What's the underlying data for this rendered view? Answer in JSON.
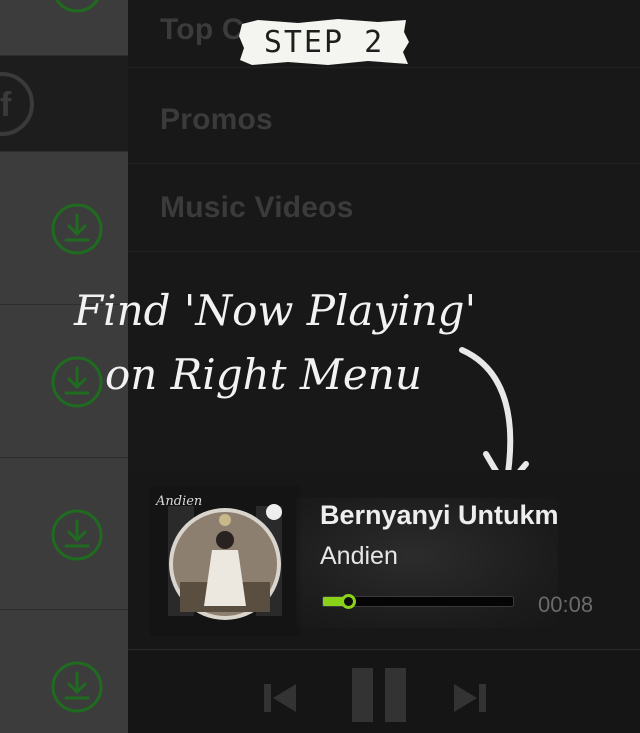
{
  "annotation": {
    "step": "STEP 2",
    "instruction_line1": "Find 'Now Playing'",
    "instruction_line2": "on Right Menu"
  },
  "menu": {
    "items": [
      {
        "label": "Top C"
      },
      {
        "label": "Promos"
      },
      {
        "label": "Music Videos"
      }
    ]
  },
  "now_playing": {
    "album_brand": "Andien",
    "song_title": "Bernyanyi Untukm",
    "artist": "Andien",
    "elapsed": "00:08",
    "progress_fraction": 0.13
  },
  "controls": {
    "previous": "previous-icon",
    "pause": "pause-icon",
    "next": "next-icon"
  },
  "colors": {
    "accent": "#8ad11a",
    "download_icon": "#1f6b1f",
    "background": "#171717"
  }
}
